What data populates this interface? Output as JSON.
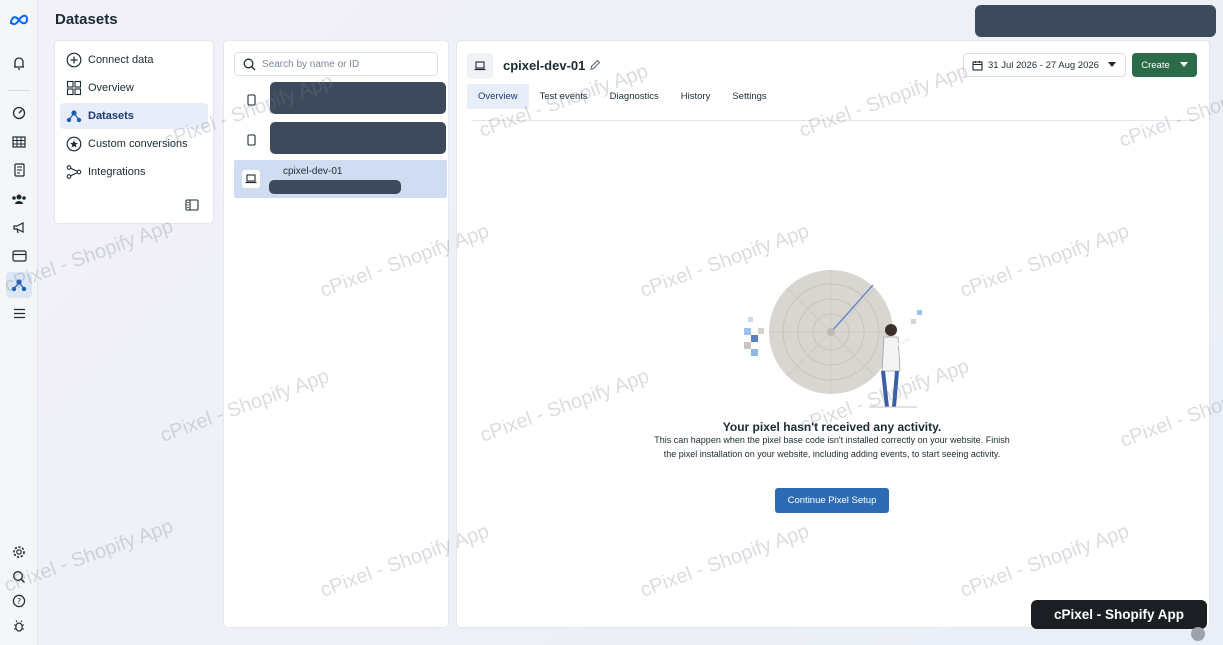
{
  "page": {
    "title": "Datasets"
  },
  "nav": {
    "items": [
      {
        "label": "Connect data",
        "icon": "plus-circle-icon"
      },
      {
        "label": "Overview",
        "icon": "grid-icon"
      },
      {
        "label": "Datasets",
        "icon": "dataset-icon",
        "active": true
      },
      {
        "label": "Custom conversions",
        "icon": "star-circle-icon"
      },
      {
        "label": "Integrations",
        "icon": "integration-icon"
      }
    ]
  },
  "list": {
    "search_placeholder": "Search by name or ID",
    "selected": {
      "name": "cpixel-dev-01"
    }
  },
  "main": {
    "dataset_name": "cpixel-dev-01",
    "date_range": "31 Jul 2026 - 27 Aug 2026",
    "create_label": "Create",
    "tabs": [
      "Overview",
      "Test events",
      "Diagnostics",
      "History",
      "Settings"
    ],
    "empty": {
      "title": "Your pixel hasn't received any activity.",
      "desc_line1": "This can happen when the pixel base code isn't installed correctly on your website.",
      "desc_line2": "Finish the pixel installation on your website, including adding events, to start seeing activity.",
      "cta": "Continue Pixel Setup"
    }
  },
  "watermark": "cPixel - Shopify App",
  "badge": "cPixel - Shopify App",
  "colors": {
    "primary": "#2e6bb5",
    "create": "#2c6b4a",
    "redacted": "#3d4a5c",
    "selected": "#cfdcf2"
  }
}
